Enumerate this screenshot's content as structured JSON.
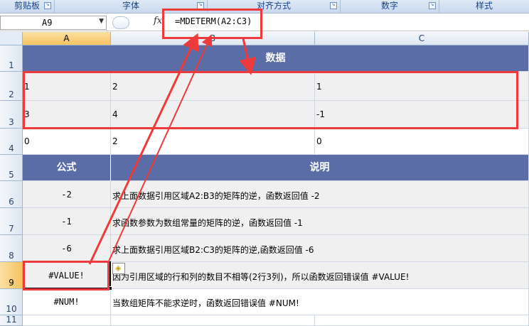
{
  "ribbon": {
    "groups": [
      "剪贴板",
      "字体",
      "对齐方式",
      "数字",
      "样式"
    ]
  },
  "formula_bar": {
    "name_box": "A9",
    "fx": "fx",
    "formula": "=MDETERM(A2:C3)"
  },
  "columns": [
    "A",
    "B",
    "C"
  ],
  "rows": [
    "1",
    "2",
    "3",
    "4",
    "5",
    "6",
    "7",
    "8",
    "9",
    "10",
    "11"
  ],
  "sheet": {
    "data_header": "数据",
    "data_rows": [
      [
        "1",
        "2",
        "1"
      ],
      [
        "3",
        "4",
        "-1"
      ],
      [
        "0",
        "2",
        "0"
      ]
    ],
    "formula_header": "公式",
    "desc_header": "说明",
    "results": [
      {
        "value": "-2",
        "desc": "求上面数据引用区域A2:B3的矩阵的逆，函数返回值 -2"
      },
      {
        "value": "-1",
        "desc": "求函数参数为数组常量的矩阵的逆，函数返回值 -1"
      },
      {
        "value": "-6",
        "desc": "求上面数据引用区域B2:C3的矩阵的逆,函数返回值 -6"
      },
      {
        "value": "#VALUE!",
        "desc": "因为引用区域的行和列的数目不相等(2行3列)，所以函数返回错误值 #VALUE!"
      },
      {
        "value": "#NUM!",
        "desc": "当数组矩阵不能求逆时，函数返回错误值 #NUM!"
      }
    ]
  },
  "colors": {
    "header_fill": "#5b6da6",
    "annotation": "#ee3a3a",
    "selected_header": "#f7c35f"
  }
}
